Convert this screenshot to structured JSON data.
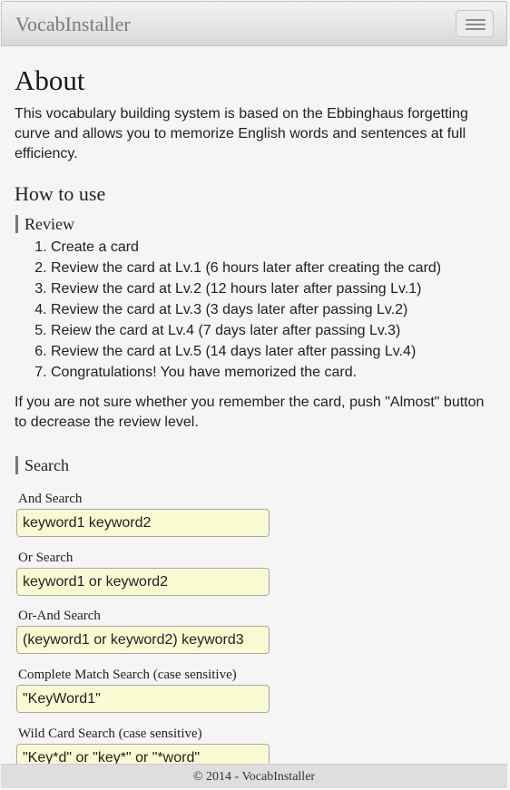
{
  "navbar": {
    "brand": "VocabInstaller",
    "menu_icon": "hamburger-icon"
  },
  "about": {
    "title": "About",
    "description": "This vocabulary building system is based on the Ebbinghaus forgetting curve and allows you to memorize English words and sentences at full efficiency."
  },
  "how_to_use": {
    "title": "How to use",
    "review": {
      "title": "Review",
      "steps": [
        "Create a card",
        "Review the card at Lv.1 (6 hours later after creating the card)",
        "Review the card at Lv.2 (12 hours later after passing Lv.1)",
        "Review the card at Lv.3 (3 days later after passing Lv.2)",
        "Reiew the card at Lv.4 (7 days later after passing Lv.3)",
        "Review the card at Lv.5 (14 days later after passing Lv.4)",
        "Congratulations! You have memorized the card."
      ],
      "note": "If you are not sure whether you remember the card, push \"Almost\" button to decrease the review level."
    },
    "search": {
      "title": "Search",
      "fields": [
        {
          "label": "And Search",
          "example": "keyword1 keyword2"
        },
        {
          "label": "Or Search",
          "example": "keyword1 or keyword2"
        },
        {
          "label": "Or-And Search",
          "example": "(keyword1 or keyword2) keyword3"
        },
        {
          "label": "Complete Match Search (case sensitive)",
          "example": "\"KeyWord1\""
        },
        {
          "label": "Wild Card Search (case sensitive)",
          "example": "\"Key*d\" or \"key*\" or \"*word\""
        }
      ]
    }
  },
  "footer": {
    "text": "© 2014 - VocabInstaller"
  }
}
